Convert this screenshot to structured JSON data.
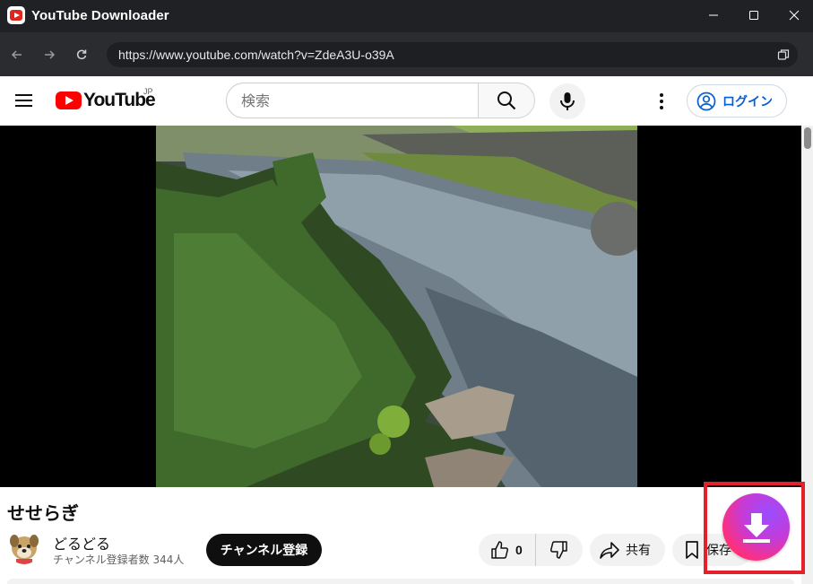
{
  "window": {
    "title": "YouTube Downloader",
    "icon": "youtube-downloader-app-icon",
    "controls": [
      "minimize-icon",
      "maximize-icon",
      "close-icon"
    ]
  },
  "navbar": {
    "url": "https://www.youtube.com/watch?v=ZdeA3U-o39A",
    "buttons": [
      "back-arrow-icon",
      "forward-arrow-icon",
      "reload-icon",
      "copy-icon"
    ]
  },
  "youtube_header": {
    "logo_text": "YouTube",
    "region": "JP",
    "search_placeholder": "検索",
    "login_label": "ログイン"
  },
  "video": {
    "title": "せせらぎ",
    "channel": {
      "name": "どるどる",
      "subscribers": "チャンネル登録者数 344人"
    },
    "subscribe_label": "チャンネル登録",
    "like_count": "0",
    "share_label": "共有",
    "save_label": "保存"
  },
  "colors": {
    "titlebar": "#202124",
    "navbar": "#2b2c30",
    "youtube_red": "#ff0000",
    "link_blue": "#065fd4",
    "highlight_red": "#e5202b"
  }
}
